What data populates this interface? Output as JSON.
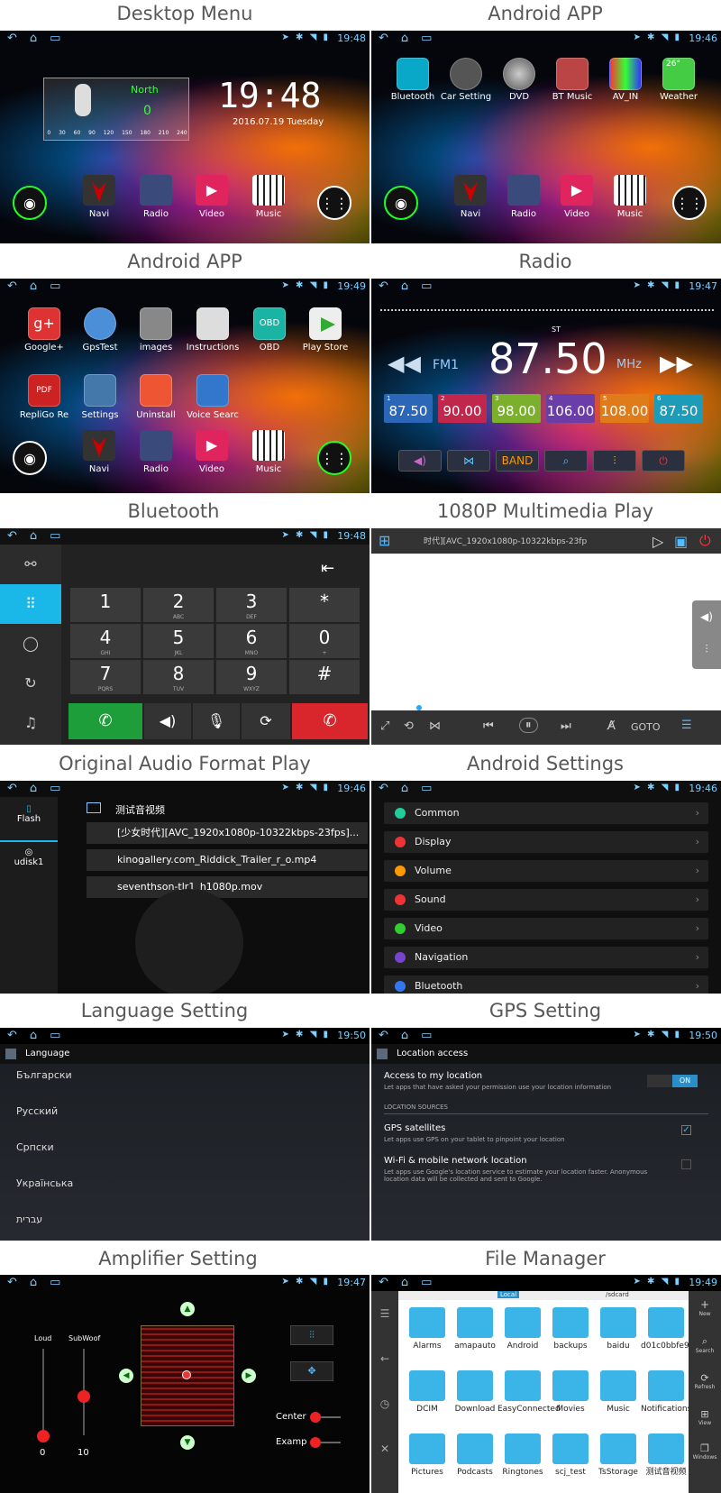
{
  "headers": {
    "desktop": "Desktop Menu",
    "android1": "Android APP",
    "android2": "Android APP",
    "radio": "Radio",
    "bluetooth": "Bluetooth",
    "multimedia": "1080P Multimedia Play",
    "audio": "Original Audio Format Play",
    "settings": "Android Settings",
    "language": "Language Setting",
    "gps": "GPS Setting",
    "amplifier": "Amplifier Setting",
    "files": "File Manager"
  },
  "status": {
    "t1": "19:48",
    "t2": "19:46",
    "t3": "19:49",
    "t4": "19:47",
    "t5": "19:48",
    "t6": "19:46",
    "t7": "19:50",
    "t8": "19:50",
    "t9": "19:47",
    "t10": "19:49"
  },
  "desktop": {
    "heading": "North",
    "speed": "0",
    "dial": "0 30 60 90 120 150 180 210 240",
    "clock": "19:48",
    "date": "2016.07.19 Tuesday"
  },
  "dock": {
    "navi": "Navi",
    "radio": "Radio",
    "video": "Video",
    "music": "Music"
  },
  "apps1": [
    "Bluetooth",
    "Car Setting",
    "DVD",
    "BT Music",
    "AV_IN",
    "Weather"
  ],
  "weather_temp": "26°",
  "apps2": [
    "Google+",
    "GpsTest",
    "images",
    "Instructions",
    "OBD",
    "Play Store",
    "RepliGo Re",
    "Settings",
    "Uninstall",
    "Voice Searc"
  ],
  "obd": "OBD",
  "pdf": "PDF",
  "radio": {
    "band": "FM1",
    "freq": "87.50",
    "unit": "MHz",
    "st": "ST",
    "band_btn": "BAND",
    "presets": [
      {
        "n": "1",
        "v": "87.50"
      },
      {
        "n": "2",
        "v": "90.00"
      },
      {
        "n": "3",
        "v": "98.00"
      },
      {
        "n": "4",
        "v": "106.00"
      },
      {
        "n": "5",
        "v": "108.00"
      },
      {
        "n": "6",
        "v": "87.50"
      }
    ]
  },
  "dialer": {
    "keys": [
      {
        "k": "1",
        "s": ""
      },
      {
        "k": "2",
        "s": "ABC"
      },
      {
        "k": "3",
        "s": "DEF"
      },
      {
        "k": "*",
        "s": ""
      },
      {
        "k": "4",
        "s": "GHI"
      },
      {
        "k": "5",
        "s": "JKL"
      },
      {
        "k": "6",
        "s": "MNO"
      },
      {
        "k": "0",
        "s": "+"
      },
      {
        "k": "7",
        "s": "PQRS"
      },
      {
        "k": "8",
        "s": "TUV"
      },
      {
        "k": "9",
        "s": "WXYZ"
      },
      {
        "k": "#",
        "s": ""
      }
    ]
  },
  "player": {
    "title": "时代][AVC_1920x1080p-10322kbps-23fp",
    "goto": "GOTO"
  },
  "audio": {
    "flash": "Flash",
    "udisk": "udisk1",
    "folder": "测试音视频",
    "files": [
      "[少女时代][AVC_1920x1080p-10322kbps-23fps]...",
      "kinogallery.com_Riddick_Trailer_r_o.mp4",
      "seventhson-tlr1_h1080p.mov"
    ]
  },
  "settings": [
    "Common",
    "Display",
    "Volume",
    "Sound",
    "Video",
    "Navigation",
    "Bluetooth"
  ],
  "language": {
    "title": "Language",
    "items": [
      "Български",
      "Русский",
      "Српски",
      "Українська",
      "עברית"
    ]
  },
  "gps": {
    "title": "Location access",
    "access": "Access to my location",
    "access_sub": "Let apps that have asked your permission use your location information",
    "on": "ON",
    "section": "LOCATION SOURCES",
    "sat": "GPS satellites",
    "sat_sub": "Let apps use GPS on your tablet to pinpoint your location",
    "wifi": "Wi-Fi & mobile network location",
    "wifi_sub": "Let apps use Google's location service to estimate your location faster. Anonymous location data will be collected and sent to Google."
  },
  "amp": {
    "loud": "Loud",
    "subwoof": "SubWoof",
    "loud_val": "0",
    "sub_val": "10",
    "center": "Center",
    "examp": "Examp"
  },
  "files": {
    "local": "Local",
    "path": "/sdcard",
    "folders": [
      "Alarms",
      "amapauto",
      "Android",
      "backups",
      "baidu",
      "d01c0bbfe940abaf",
      "DCIM",
      "Download",
      "EasyConnected",
      "Movies",
      "Music",
      "Notifications",
      "Pictures",
      "Podcasts",
      "Ringtones",
      "scj_test",
      "TsStorage",
      "测试音视频"
    ],
    "side": [
      "New",
      "Search",
      "Refresh",
      "View",
      "Windows"
    ]
  }
}
